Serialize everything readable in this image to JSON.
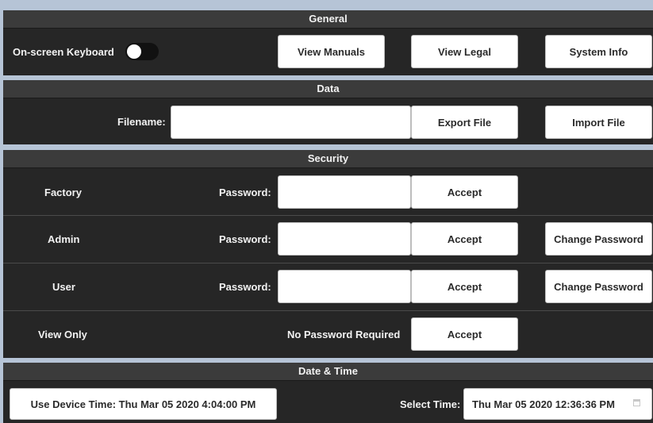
{
  "general": {
    "header": "General",
    "keyboard_label": "On-screen Keyboard",
    "keyboard_on": false,
    "view_manuals": "View Manuals",
    "view_legal": "View Legal",
    "system_info": "System Info"
  },
  "data": {
    "header": "Data",
    "filename_label": "Filename:",
    "filename_value": "",
    "export": "Export File",
    "import": "Import File"
  },
  "security": {
    "header": "Security",
    "rows": [
      {
        "role": "Factory",
        "password_label": "Password:",
        "accept": "Accept",
        "change": ""
      },
      {
        "role": "Admin",
        "password_label": "Password:",
        "accept": "Accept",
        "change": "Change Password"
      },
      {
        "role": "User",
        "password_label": "Password:",
        "accept": "Accept",
        "change": "Change Password"
      },
      {
        "role": "View Only",
        "no_password": "No Password Required",
        "accept": "Accept"
      }
    ]
  },
  "datetime": {
    "header": "Date & Time",
    "device_time": "Use Device Time: Thu Mar 05 2020 4:04:00 PM",
    "select_label": "Select Time:",
    "select_value": "Thu Mar 05 2020 12:36:36 PM",
    "icon": "calendar-icon"
  }
}
